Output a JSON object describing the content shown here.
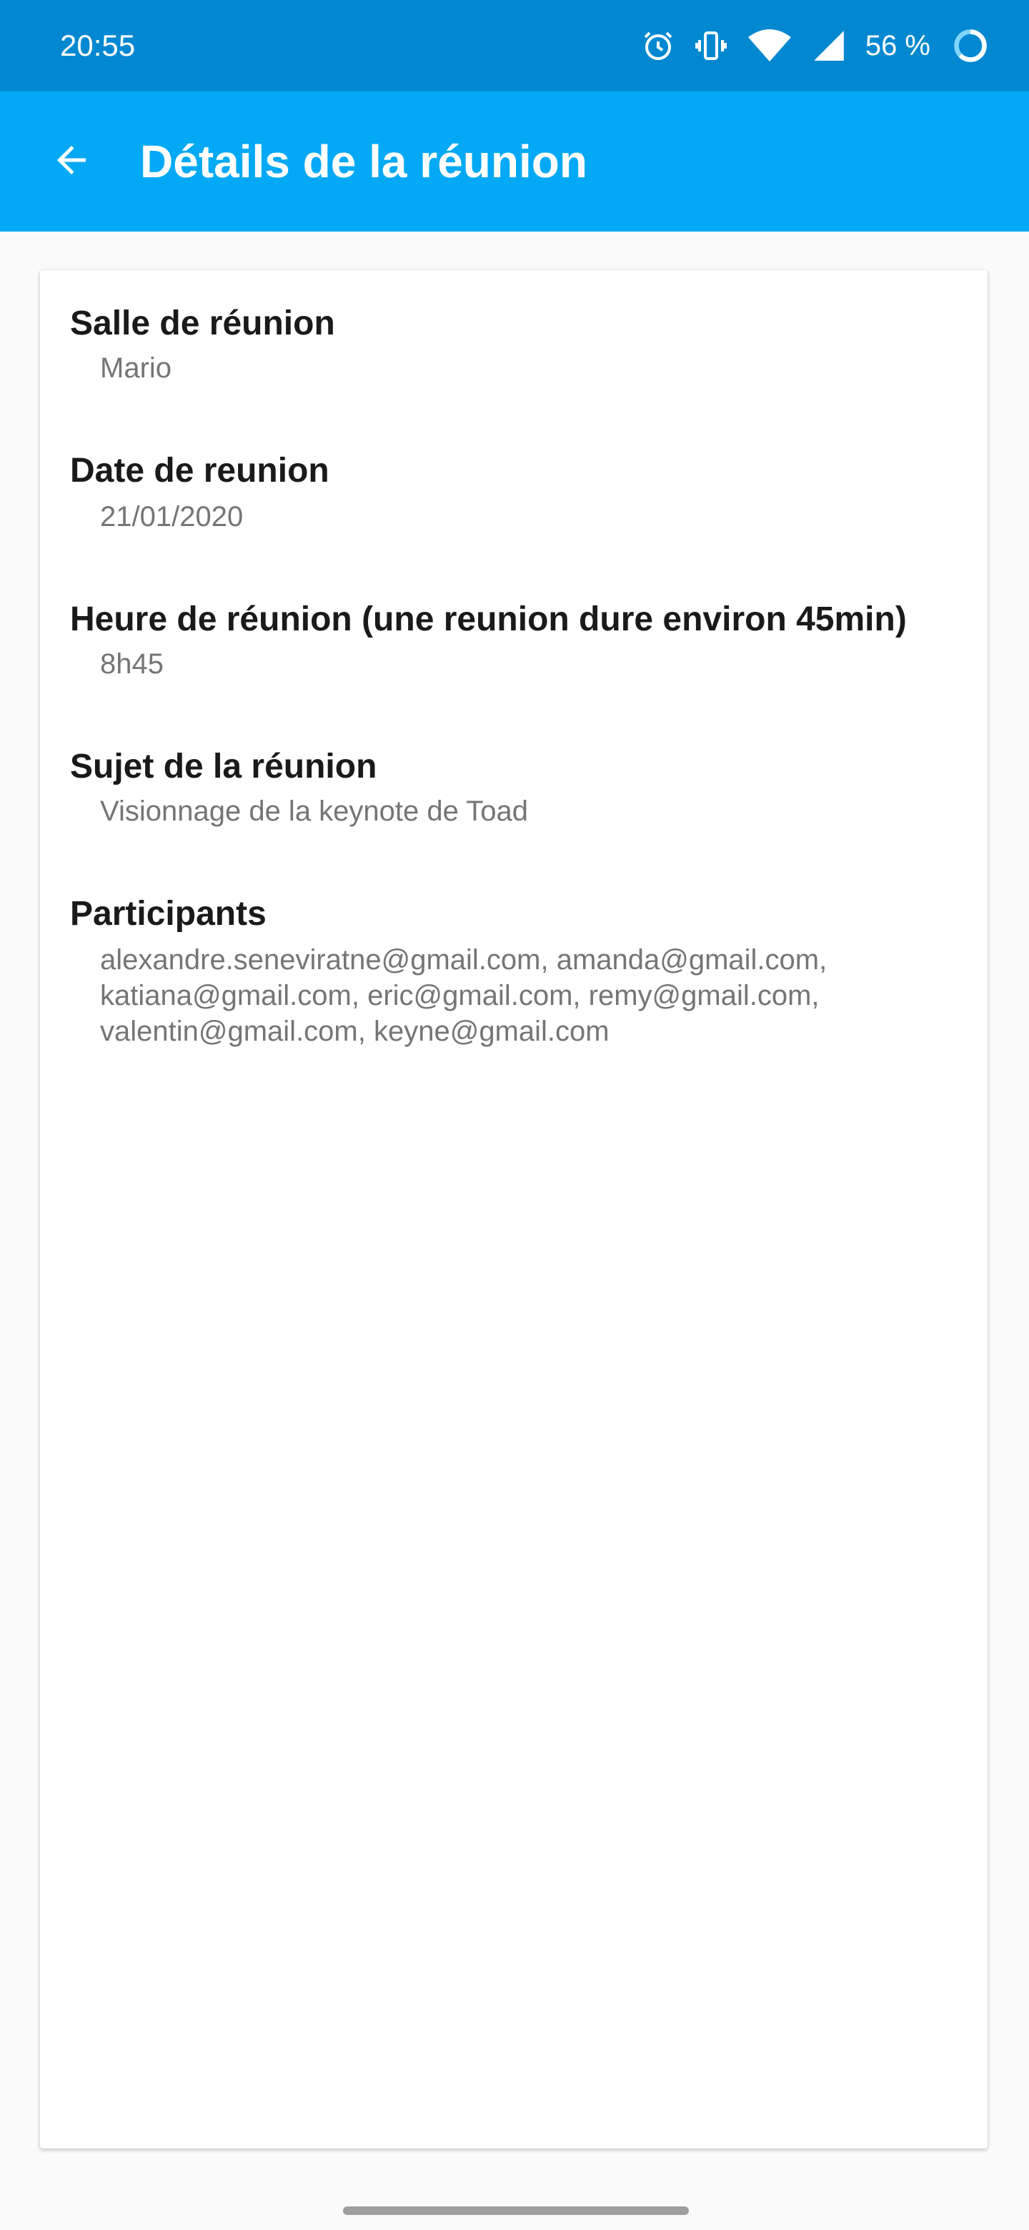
{
  "status_bar": {
    "time": "20:55",
    "battery": "56 %",
    "icons": [
      "alarm-icon",
      "vibrate-icon",
      "wifi-icon",
      "signal-icon",
      "battery-icon"
    ]
  },
  "app_bar": {
    "title": "Détails de la réunion",
    "back_icon": "arrow-back-icon"
  },
  "details": {
    "room_label": "Salle de réunion",
    "room_value": "Mario",
    "date_label": "Date de reunion",
    "date_value": "21/01/2020",
    "time_label": "Heure de réunion (une reunion dure environ 45min)",
    "time_value": "8h45",
    "subject_label": "Sujet de la réunion",
    "subject_value": "Visionnage de la keynote de Toad",
    "participants_label": "Participants",
    "participants_lines": [
      "alexandre.seneviratne@gmail.com, amanda@gmail.com,",
      "katiana@gmail.com, eric@gmail.com, remy@gmail.com,",
      "valentin@gmail.com, keyne@gmail.com"
    ]
  },
  "colors": {
    "status_bar": "#0288d1",
    "app_bar": "#03a9f4",
    "label": "#1a1a1a",
    "value": "#757575"
  }
}
